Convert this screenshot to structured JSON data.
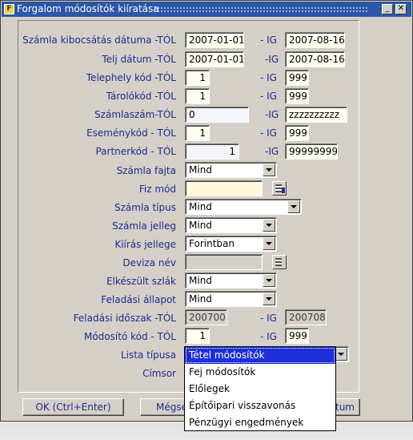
{
  "window": {
    "title": "Forgalom módosítók kiíratása"
  },
  "rows": {
    "szamla_kibocsatas": {
      "label": "Számla kibocsátás dátuma -TÓL",
      "from": "2007-01-01",
      "ig": "- IG",
      "to": "2007-08-16"
    },
    "telj_datum": {
      "label": "Telj dátum -TÓL",
      "from": "2007-01-01",
      "ig": "-IG",
      "to": "2007-08-16"
    },
    "telephely": {
      "label": "Telephely kód -TÓL",
      "from": "1",
      "ig": "- IG",
      "to": "999"
    },
    "tarolo": {
      "label": "Tárolókód -TÓL",
      "from": "1",
      "ig": "- IG",
      "to": "999"
    },
    "szamlaszam": {
      "label": "Számlaszám-TÓL",
      "from": "0",
      "ig": "-IG",
      "to": "zzzzzzzzzz"
    },
    "esemeny": {
      "label": "Eseménykód - TÓL",
      "from": "1",
      "ig": "- IG",
      "to": "999"
    },
    "partner": {
      "label": "Partnerkód - TÓL",
      "from": "1",
      "ig": "-IG",
      "to": "99999999"
    },
    "szamla_fajta": {
      "label": "Számla fajta",
      "value": "Mind"
    },
    "fiz_mod": {
      "label": "Fiz mód",
      "value": ""
    },
    "szamla_tipus": {
      "label": "Számla típus",
      "value": "Mind"
    },
    "szamla_jelleg": {
      "label": "Számla jelleg",
      "value": "Mind"
    },
    "kiiras_jellege": {
      "label": "Kiírás jellege",
      "value": "Forintban"
    },
    "deviza_nev": {
      "label": "Deviza név",
      "value": ""
    },
    "elkeszult": {
      "label": "Elkészült szlák",
      "value": "Mind"
    },
    "feladasi_allapot": {
      "label": "Feladási állapot",
      "value": "Mind"
    },
    "feladasi_idoszak": {
      "label": "Feladási időszak -TÓL",
      "from": "200700",
      "ig": "- IG",
      "to": "200708"
    },
    "modosito_kod": {
      "label": "Módosító kód - TÓL",
      "from": "1",
      "ig": "- IG",
      "to": "999"
    },
    "lista_tipusa": {
      "label": "Lista típusa"
    },
    "cimsor": {
      "label": "Címsor"
    }
  },
  "dropdown": {
    "options": [
      "Tétel módosítók",
      "Fej módosítók",
      "Előlegek",
      "Építőipari visszavonás",
      "Pénzügyi engedmények"
    ],
    "selected_index": 0
  },
  "buttons": {
    "ok": "OK (Ctrl+Enter)",
    "megse": "Mégse",
    "datum": "tum"
  }
}
